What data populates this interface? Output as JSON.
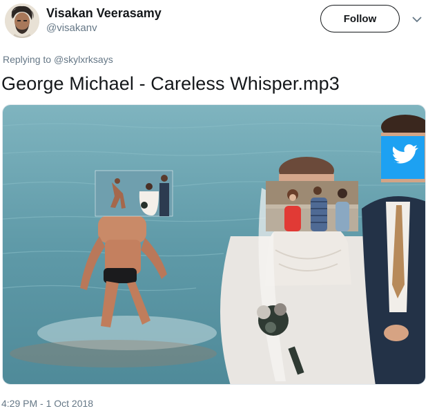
{
  "user": {
    "display_name": "Visakan Veerasamy",
    "handle": "@visakanv",
    "follow_label": "Follow"
  },
  "reply": {
    "prefix": "Replying to",
    "mention": "@skylxrksays"
  },
  "tweet": {
    "text": "George Michael - Careless Whisper.mp3",
    "timestamp": "4:29 PM - 1 Oct 2018"
  },
  "media": {
    "description_icons": [
      "twitter-bird-icon"
    ],
    "colors": {
      "sea": "#5f9aa8",
      "twitter_blue": "#1da1f2"
    }
  }
}
